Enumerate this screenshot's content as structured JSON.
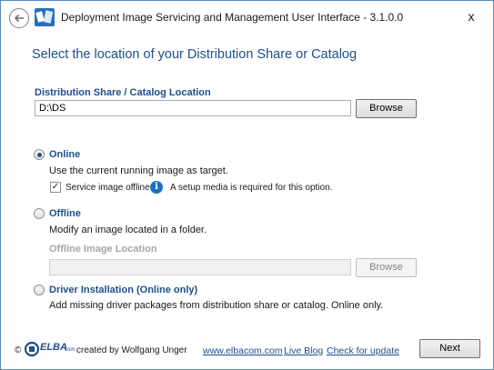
{
  "window": {
    "title": "Deployment Image Servicing and Management User Interface - 3.1.0.0",
    "close_label": "x"
  },
  "page": {
    "heading": "Select the location of your Distribution Share or Catalog"
  },
  "share": {
    "label": "Distribution Share / Catalog Location",
    "value": "D:\\DS",
    "browse_label": "Browse"
  },
  "online": {
    "label": "Online",
    "selected": true,
    "description": "Use the current running image as target.",
    "service_offline_label": "Service image offline",
    "service_offline_checked": true,
    "info_text": "A setup media is required for this option."
  },
  "offline": {
    "label": "Offline",
    "description": "Modify an image located in a folder.",
    "location_label": "Offline Image Location",
    "location_value": "",
    "browse_label": "Browse"
  },
  "driver": {
    "label": "Driver Installation (Online only)",
    "description": "Add missing driver packages from distribution share or catalog. Online only."
  },
  "footer": {
    "copyright": "©",
    "logo_text": "ELBA",
    "logo_suffix": "com",
    "created_by": "created by Wolfgang Unger",
    "links": [
      "www.elbacom.com",
      "Live Blog",
      "Check for update"
    ],
    "next_label": "Next"
  },
  "colors": {
    "accent": "#1f4e8c",
    "info_icon": "#1f6fc4"
  }
}
